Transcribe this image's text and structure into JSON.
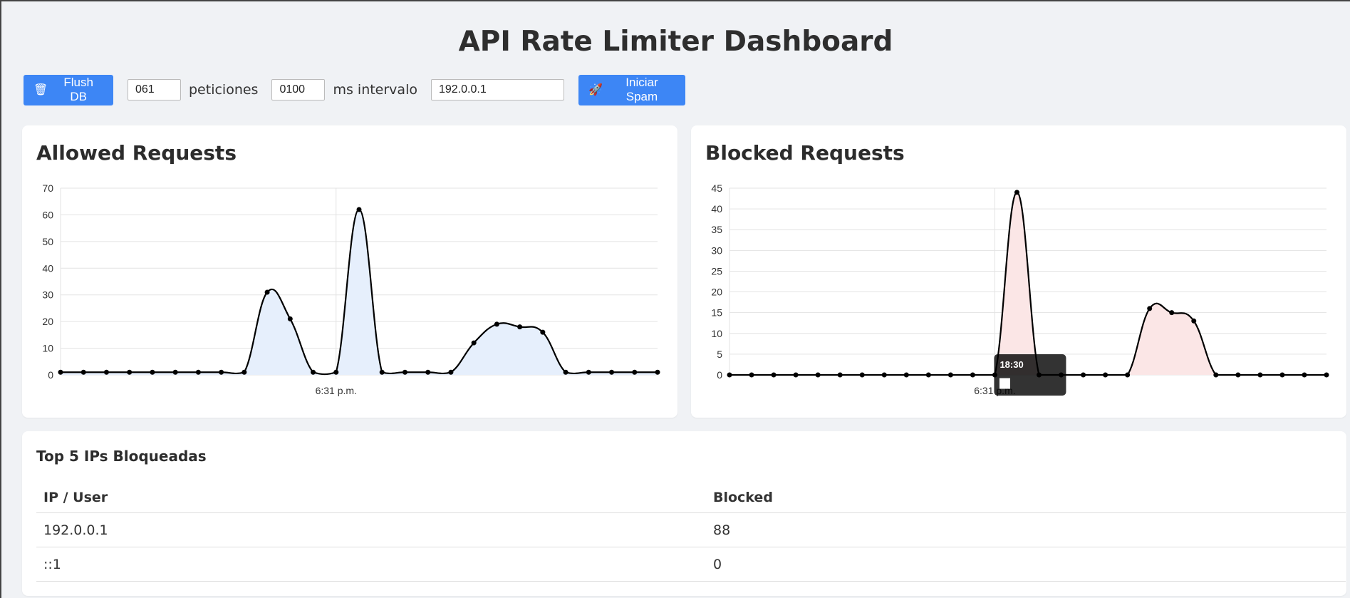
{
  "title": "API Rate Limiter Dashboard",
  "controls": {
    "flush_label": "Flush DB",
    "flush_icon": "trash-icon",
    "requests_value": "061",
    "requests_label": "peticiones",
    "interval_value": "0100",
    "interval_label": "ms intervalo",
    "ip_value": "192.0.0.1",
    "spam_label": "Iniciar Spam",
    "spam_icon": "rocket-icon",
    "button_color": "#3d86f5"
  },
  "allowed": {
    "title": "Allowed Requests",
    "chart_data": {
      "type": "area",
      "x_label": "6:31 p.m.",
      "ylim": [
        0,
        70
      ],
      "y_ticks": [
        0,
        10,
        20,
        30,
        40,
        50,
        60,
        70
      ],
      "values": [
        1,
        1,
        1,
        1,
        1,
        1,
        1,
        1,
        1,
        31,
        21,
        1,
        1,
        62,
        1,
        1,
        1,
        1,
        12,
        19,
        18,
        16,
        1,
        1,
        1,
        1,
        1
      ],
      "fill": "#e6effc",
      "line": "#000000",
      "grid": true
    }
  },
  "blocked": {
    "title": "Blocked Requests",
    "chart_data": {
      "type": "area",
      "x_label": "6:31 p.m.",
      "ylim": [
        0,
        45
      ],
      "y_ticks": [
        0,
        5,
        10,
        15,
        20,
        25,
        30,
        35,
        40,
        45
      ],
      "values": [
        0,
        0,
        0,
        0,
        0,
        0,
        0,
        0,
        0,
        0,
        0,
        0,
        0,
        44,
        0,
        0,
        0,
        0,
        0,
        16,
        15,
        13,
        0,
        0,
        0,
        0,
        0,
        0
      ],
      "fill": "#fbe6e6",
      "line": "#000000",
      "grid": true,
      "tooltip": {
        "title": "18:30"
      }
    }
  },
  "top_ips": {
    "title": "Top 5 IPs Bloqueadas",
    "columns": [
      "IP / User",
      "Blocked"
    ],
    "rows": [
      [
        "192.0.0.1",
        "88"
      ],
      [
        "::1",
        "0"
      ]
    ]
  }
}
